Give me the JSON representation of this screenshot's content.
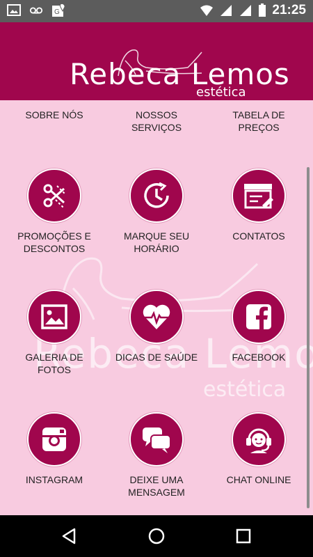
{
  "status_bar": {
    "time": "21:25",
    "icons": [
      "image-icon",
      "voicemail-icon",
      "maps-icon",
      "wifi-icon",
      "signal-icon",
      "signal-icon",
      "battery-icon"
    ]
  },
  "header": {
    "brand_name": "Rebeca Lemos",
    "brand_sub": "estética"
  },
  "watermark": {
    "brand_name": "Rebeca Lemos",
    "brand_sub": "estética"
  },
  "menu": {
    "top_row": [
      {
        "label": "SOBRE NÓS"
      },
      {
        "label": "NOSSOS SERVIÇOS"
      },
      {
        "label": "TABELA DE PREÇOS"
      }
    ],
    "items": [
      {
        "label": "PROMOÇÕES E DESCONTOS",
        "icon": "scissors-icon"
      },
      {
        "label": "MARQUE SEU HORÁRIO",
        "icon": "clock-icon"
      },
      {
        "label": "CONTATOS",
        "icon": "contacts-icon"
      },
      {
        "label": "GALERIA DE FOTOS",
        "icon": "gallery-icon"
      },
      {
        "label": "DICAS DE SAÚDE",
        "icon": "heart-icon"
      },
      {
        "label": "FACEBOOK",
        "icon": "facebook-icon"
      },
      {
        "label": "INSTAGRAM",
        "icon": "instagram-icon"
      },
      {
        "label": "DEIXE UMA MENSAGEM",
        "icon": "chat-bubbles-icon"
      },
      {
        "label": "CHAT ONLINE",
        "icon": "support-agent-icon"
      }
    ]
  },
  "colors": {
    "brand": "#a0064d",
    "background": "#f8cbe0",
    "status_bar": "#5c5c5c",
    "nav_bar": "#000000"
  }
}
